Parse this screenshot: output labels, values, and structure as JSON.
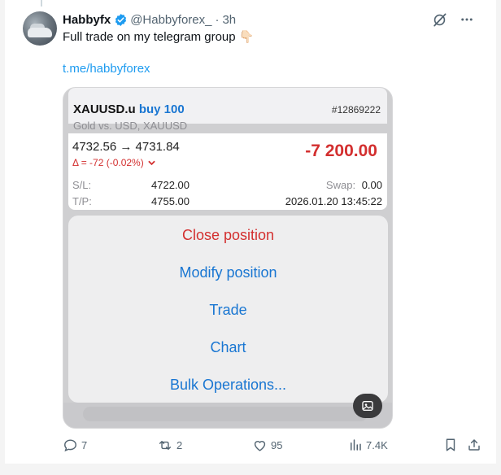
{
  "post": {
    "display_name": "Habbyfx",
    "handle": "@Habbyforex_",
    "separator": "·",
    "time": "3h",
    "text": "Full trade on my telegram group",
    "emoji": "👇🏻",
    "link": "t.me/habbyforex"
  },
  "trade": {
    "symbol": "XAUUSD.u",
    "side_volume": "buy 100",
    "description": "Gold vs. USD, XAUUSD",
    "ticket": "#12869222",
    "open_close": "4732.56 → 4731.84",
    "delta": "Δ = -72 (-0.02%)",
    "profit": "-7 200.00",
    "sl_label": "S/L:",
    "sl_value": "4722.00",
    "swap_label": "Swap:",
    "swap_value": "0.00",
    "tp_label": "T/P:",
    "tp_value": "4755.00",
    "datetime": "2026.01.20 13:45:22"
  },
  "menu": {
    "items": [
      "Close position",
      "Modify position",
      "Trade",
      "Chart",
      "Bulk Operations..."
    ]
  },
  "engagement": {
    "replies": "7",
    "reposts": "2",
    "likes": "95",
    "views": "7.4K"
  },
  "colors": {
    "accent": "#1d9bf0",
    "loss": "#d32f2f",
    "menu_blue": "#1976d2",
    "verified": "#1d9bf0"
  },
  "icons": [
    "verified-badge-icon",
    "grok-icon",
    "more-icon",
    "reply-icon",
    "repost-icon",
    "like-icon",
    "views-icon",
    "bookmark-icon",
    "share-icon",
    "alt-image-icon",
    "chevron-down-icon"
  ]
}
